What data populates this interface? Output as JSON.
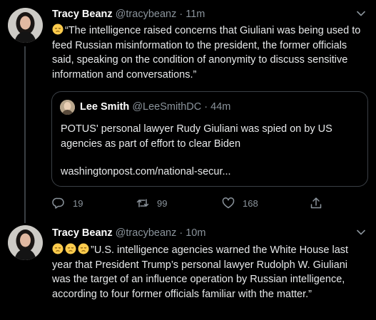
{
  "tweets": [
    {
      "author": {
        "name": "Tracy Beanz",
        "handle": "@tracybeanz",
        "separator": "·",
        "time": "11m"
      },
      "emoji": [
        "pensive-face"
      ],
      "text": "“The intelligence raised concerns that Giuliani was being used to feed Russian misinformation to the president, the former officials said, speaking on the condition of anonymity to discuss sensitive information and conversations.”",
      "quote": {
        "author": {
          "name": "Lee Smith",
          "handle": "@LeeSmithDC",
          "separator": "·",
          "time": "44m"
        },
        "text": "POTUS' personal lawyer Rudy Giuliani was spied on by US agencies as part of effort to clear Biden",
        "link": "washingtonpost.com/national-secur..."
      },
      "actions": {
        "replies": "19",
        "retweets": "99",
        "likes": "168"
      }
    },
    {
      "author": {
        "name": "Tracy Beanz",
        "handle": "@tracybeanz",
        "separator": "·",
        "time": "10m"
      },
      "emoji": [
        "pensive-face",
        "pensive-face",
        "pensive-face"
      ],
      "text": "”U.S. intelligence agencies warned the White House last year that President Trump’s personal lawyer Rudolph W. Giuliani was the target of an influence operation by Russian intelligence, according to four former officials familiar with the matter.”"
    }
  ],
  "colors": {
    "background": "#000000",
    "text": "#e7e9ea",
    "muted": "#8a939b",
    "border": "#3b4046"
  }
}
